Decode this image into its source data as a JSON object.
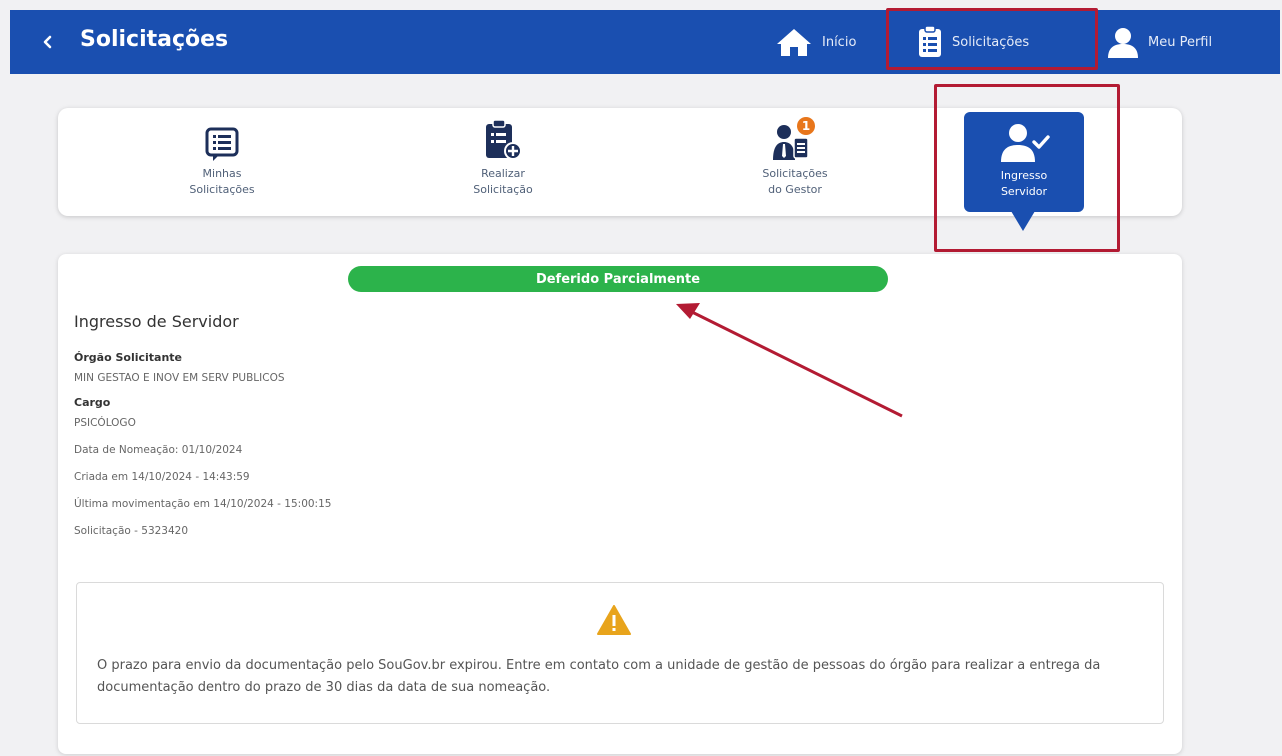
{
  "header": {
    "title": "Solicitações",
    "nav": [
      {
        "label": "Início",
        "icon": "home-icon"
      },
      {
        "label": "Solicitações",
        "icon": "clipboard-icon"
      },
      {
        "label": "Meu Perfil",
        "icon": "user-icon"
      }
    ]
  },
  "tabs": [
    {
      "line1": "Minhas",
      "line2": "Solicitações",
      "icon": "list-icon"
    },
    {
      "line1": "Realizar",
      "line2": "Solicitação",
      "icon": "clipboard-add-icon"
    },
    {
      "line1": "Solicitações",
      "line2": "do Gestor",
      "icon": "manager-icon",
      "badge": "1"
    },
    {
      "line1": "Ingresso",
      "line2": "Servidor",
      "icon": "user-check-icon",
      "active": true
    }
  ],
  "detail": {
    "status": "Deferido Parcialmente",
    "title": "Ingresso de Servidor",
    "orgao_label": "Órgão Solicitante",
    "orgao_value": "MIN GESTAO E INOV EM SERV PUBLICOS",
    "cargo_label": "Cargo",
    "cargo_value": "PSICÓLOGO",
    "data_nomeacao": "Data de Nomeação: 01/10/2024",
    "criada_em": "Criada em 14/10/2024 - 14:43:59",
    "ultima_mov": "Última movimentação em 14/10/2024 - 15:00:15",
    "solicitacao": "Solicitação - 5323420"
  },
  "warning": {
    "icon": "warning-icon",
    "text": "O prazo para envio da documentação pelo SouGov.br expirou. Entre em contato com a unidade de gestão de pessoas do órgão para realizar a entrega da documentação dentro do prazo de 30 dias da data de sua nomeação."
  },
  "colors": {
    "primary": "#1a4fb0",
    "status_green": "#2cb34b",
    "highlight_red": "#b31b33",
    "badge_orange": "#e8761b",
    "warning_amber": "#e8a41c"
  }
}
